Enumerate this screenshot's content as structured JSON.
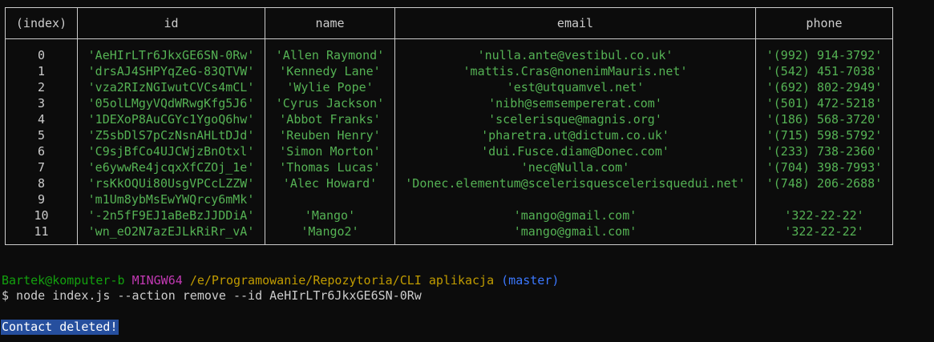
{
  "table": {
    "headers": [
      "(index)",
      "id",
      "name",
      "email",
      "phone"
    ],
    "rows": [
      {
        "index": "0",
        "id": "'AeHIrLTr6JkxGE6SN-0Rw'",
        "name": "'Allen Raymond'",
        "email": "'nulla.ante@vestibul.co.uk'",
        "phone": "'(992) 914-3792'"
      },
      {
        "index": "1",
        "id": "'drsAJ4SHPYqZeG-83QTVW'",
        "name": "'Kennedy Lane'",
        "email": "'mattis.Cras@nonenimMauris.net'",
        "phone": "'(542) 451-7038'"
      },
      {
        "index": "2",
        "id": "'vza2RIzNGIwutCVCs4mCL'",
        "name": "'Wylie Pope'",
        "email": "'est@utquamvel.net'",
        "phone": "'(692) 802-2949'"
      },
      {
        "index": "3",
        "id": "'05olLMgyVQdWRwgKfg5J6'",
        "name": "'Cyrus Jackson'",
        "email": "'nibh@semsempererat.com'",
        "phone": "'(501) 472-5218'"
      },
      {
        "index": "4",
        "id": "'1DEXoP8AuCGYc1YgoQ6hw'",
        "name": "'Abbot Franks'",
        "email": "'scelerisque@magnis.org'",
        "phone": "'(186) 568-3720'"
      },
      {
        "index": "5",
        "id": "'Z5sbDlS7pCzNsnAHLtDJd'",
        "name": "'Reuben Henry'",
        "email": "'pharetra.ut@dictum.co.uk'",
        "phone": "'(715) 598-5792'"
      },
      {
        "index": "6",
        "id": "'C9sjBfCo4UJCWjzBnOtxl'",
        "name": "'Simon Morton'",
        "email": "'dui.Fusce.diam@Donec.com'",
        "phone": "'(233) 738-2360'"
      },
      {
        "index": "7",
        "id": "'e6ywwRe4jcqxXfCZOj_1e'",
        "name": "'Thomas Lucas'",
        "email": "'nec@Nulla.com'",
        "phone": "'(704) 398-7993'"
      },
      {
        "index": "8",
        "id": "'rsKkOQUi80UsgVPCcLZZW'",
        "name": "'Alec Howard'",
        "email": "'Donec.elementum@scelerisquescelerisquedui.net'",
        "phone": "'(748) 206-2688'"
      },
      {
        "index": "9",
        "id": "'m1Um8ybMsEwYWQrcy6mMk'",
        "name": "",
        "email": "",
        "phone": ""
      },
      {
        "index": "10",
        "id": "'-2n5fF9EJ1aBeBzJJDDiA'",
        "name": "'Mango'",
        "email": "'mango@gmail.com'",
        "phone": "'322-22-22'"
      },
      {
        "index": "11",
        "id": "'wn_eO2N7azEJLkRiRr_vA'",
        "name": "'Mango2'",
        "email": "'mango@gmail.com'",
        "phone": "'322-22-22'"
      }
    ]
  },
  "prompt": {
    "user_host": "Bartek@komputer-b",
    "system": "MINGW64",
    "path": "/e/Programowanie/Repozytoria/CLI aplikacja",
    "branch": "(master)"
  },
  "command": "$ node index.js --action remove --id AeHIrLTr6JkxGE6SN-0Rw",
  "output_message": "Contact deleted!",
  "colors": {
    "background": "#0c0c0c",
    "text": "#cccccc",
    "string_value": "#55b254",
    "user_host": "#13a10e",
    "system": "#c239b3",
    "path": "#c19c00",
    "branch": "#3b78ff",
    "selection": "#264f9e"
  }
}
